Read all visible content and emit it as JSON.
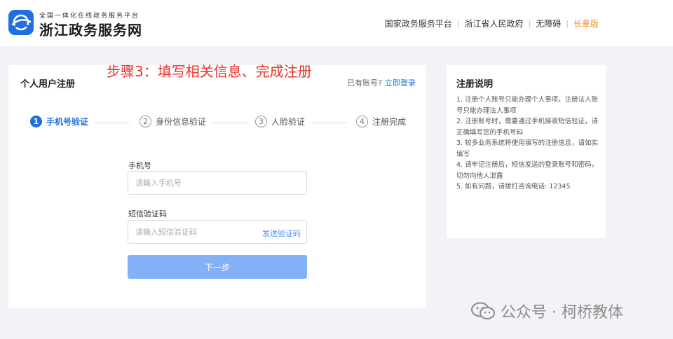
{
  "header": {
    "logo_subtitle": "全国一体化在线政务服务平台",
    "logo_title": "浙江政务服务网",
    "nav": [
      "国家政务服务平台",
      "浙江省人民政府",
      "无障碍",
      "长辈版"
    ]
  },
  "annotation": "步骤3：填写相关信息、完成注册",
  "card": {
    "title": "个人用户注册",
    "login_prompt": "已有账号?",
    "login_link": "立即登录"
  },
  "steps": [
    {
      "num": "1",
      "label": "手机号验证",
      "active": true
    },
    {
      "num": "2",
      "label": "身份信息验证",
      "active": false
    },
    {
      "num": "3",
      "label": "人脸验证",
      "active": false
    },
    {
      "num": "4",
      "label": "注册完成",
      "active": false
    }
  ],
  "form": {
    "phone_label": "手机号",
    "phone_placeholder": "请输入手机号",
    "sms_label": "短信验证码",
    "sms_placeholder": "请输入短信验证码",
    "send_code": "发送验证码",
    "next": "下一步"
  },
  "side": {
    "title": "注册说明",
    "items": [
      "1. 注册个人账号只能办理个人事项，注册法人账号只能办理法人事项",
      "2. 注册账号时，需要通过手机接收短信验证，请正确填写您的手机号码",
      "3. 较多业务系统将使用填写的注册信息，请如实填写",
      "4. 请牢记注册后，短信发送的登录账号和密码，切勿向他人泄露",
      "5. 如有问题，请拨打咨询电话: 12345"
    ]
  },
  "watermark": "公众号 · 柯桥教体",
  "icons": {
    "logo": "globe-swoosh-icon",
    "watermark": "wechat-icon"
  },
  "colors": {
    "primary": "#1f6fe0",
    "button": "#82b1f6",
    "annotation": "#e8332a",
    "elder_link": "#f08a24"
  }
}
